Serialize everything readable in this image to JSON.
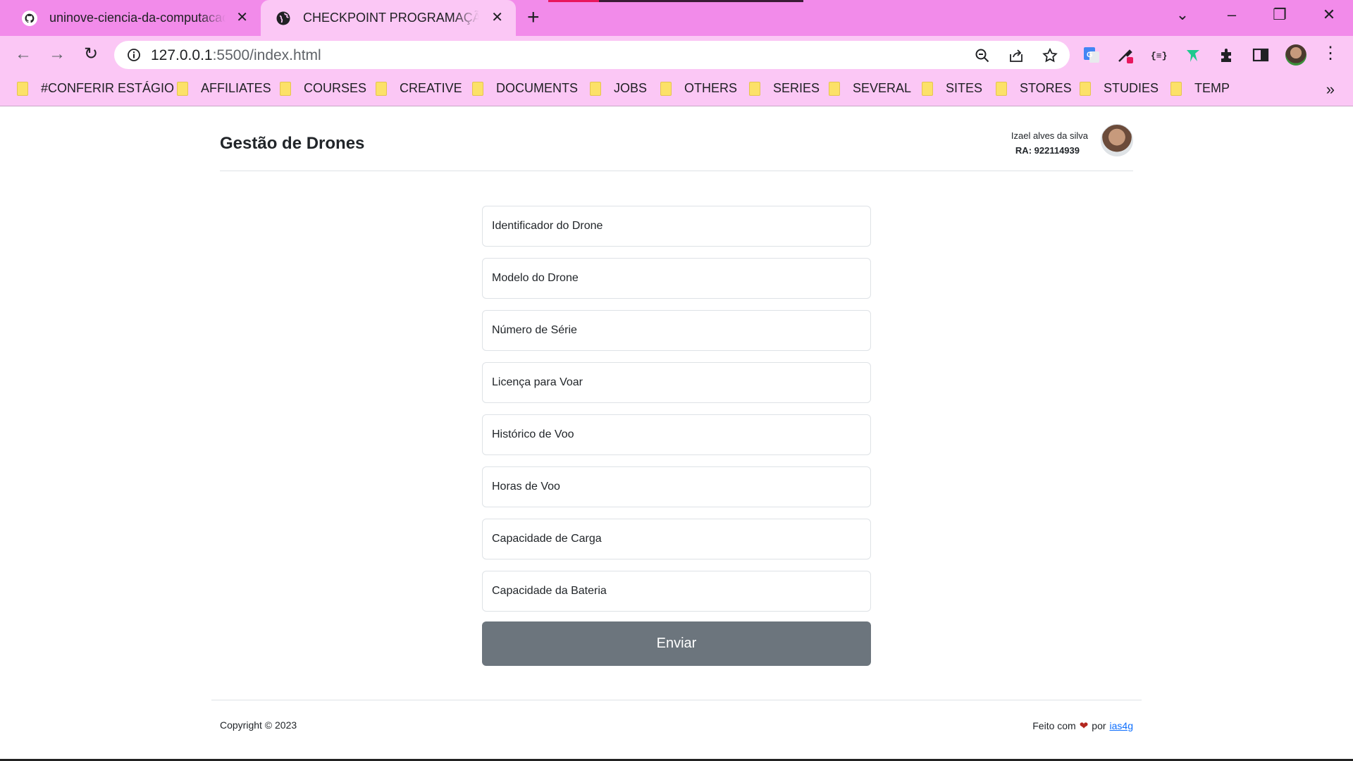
{
  "browser": {
    "tabs": [
      {
        "title": "uninove-ciencia-da-computacao/",
        "icon": "github-icon"
      },
      {
        "title": "CHECKPOINT PROGRAMAÇÃO WEB",
        "icon": "globe-icon",
        "active": true
      }
    ],
    "new_tab": "+",
    "url_host": "127.0.0.1",
    "url_rest": ":5500/index.html",
    "bookmarks": [
      "#CONFERIR ESTÁGIO",
      "AFFILIATES",
      "COURSES",
      "CREATIVE",
      "DOCUMENTS",
      "JOBS",
      "OTHERS",
      "SERIES",
      "SEVERAL",
      "SITES",
      "STORES",
      "STUDIES",
      "TEMP"
    ],
    "bookmarks_more": "»",
    "colors": {
      "tabstrip": "#f28bea",
      "toolbar": "#fbc7f5"
    }
  },
  "header": {
    "title": "Gestão de Drones",
    "user_name": "Izael alves da silva",
    "user_ra": "RA: 922114939"
  },
  "form": {
    "fields": [
      {
        "placeholder": "Identificador do Drone"
      },
      {
        "placeholder": "Modelo do Drone"
      },
      {
        "placeholder": "Número de Série"
      },
      {
        "placeholder": "Licença para Voar"
      },
      {
        "placeholder": "Histórico de Voo"
      },
      {
        "placeholder": "Horas de Voo"
      },
      {
        "placeholder": "Capacidade de Carga"
      },
      {
        "placeholder": "Capacidade da Bateria"
      }
    ],
    "submit_label": "Enviar",
    "submit_color": "#6c757d"
  },
  "footer": {
    "copyright": "Copyright © 2023",
    "made_with": "Feito com",
    "by": "por",
    "author_link": "ias4g"
  }
}
